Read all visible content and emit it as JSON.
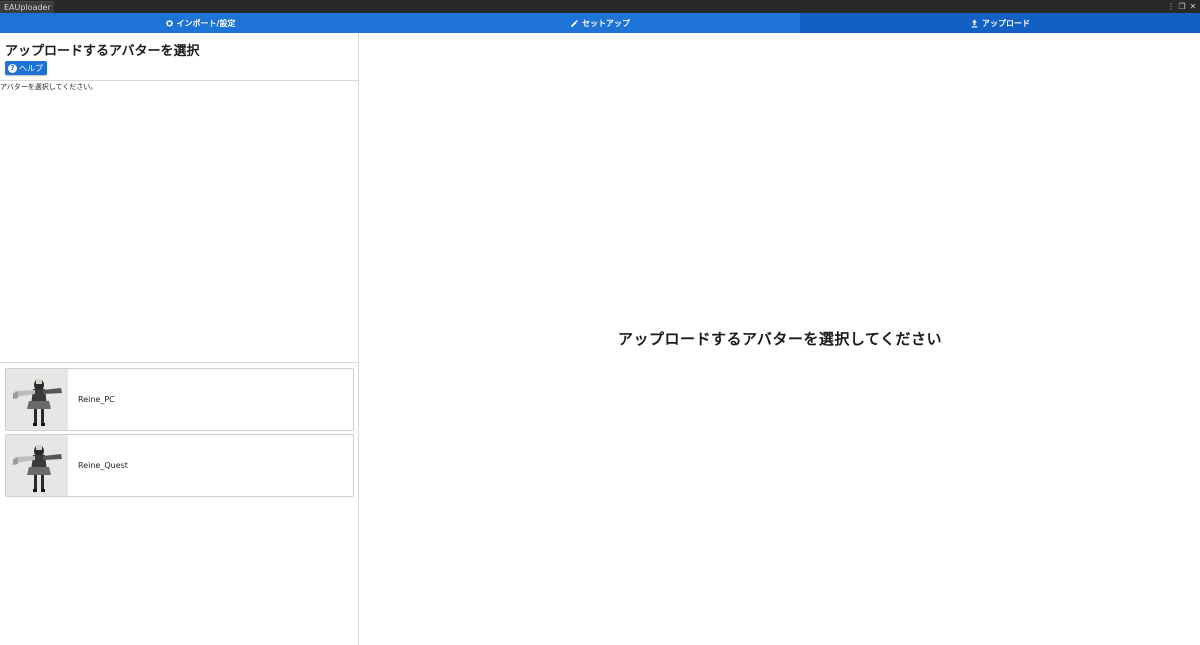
{
  "window": {
    "tab_title": "EAUploader",
    "controls": [
      "⋮",
      "❐",
      "✕"
    ]
  },
  "tabs": [
    {
      "label": "インポート/設定",
      "icon": "gear-icon",
      "active": false
    },
    {
      "label": "セットアップ",
      "icon": "pencil-icon",
      "active": false
    },
    {
      "label": "アップロード",
      "icon": "upload-icon",
      "active": true
    }
  ],
  "left_panel": {
    "title": "アップロードするアバターを選択",
    "help_label": "ヘルプ",
    "help_icon_glyph": "?",
    "instruction": "アバターを選択してください。",
    "avatars": [
      {
        "name": "Reine_PC"
      },
      {
        "name": "Reine_Quest"
      }
    ]
  },
  "main": {
    "message": "アップロードするアバターを選択してください"
  },
  "colors": {
    "accent": "#1e73d6",
    "accent_active": "#1360c4",
    "titlebar": "#282828"
  }
}
